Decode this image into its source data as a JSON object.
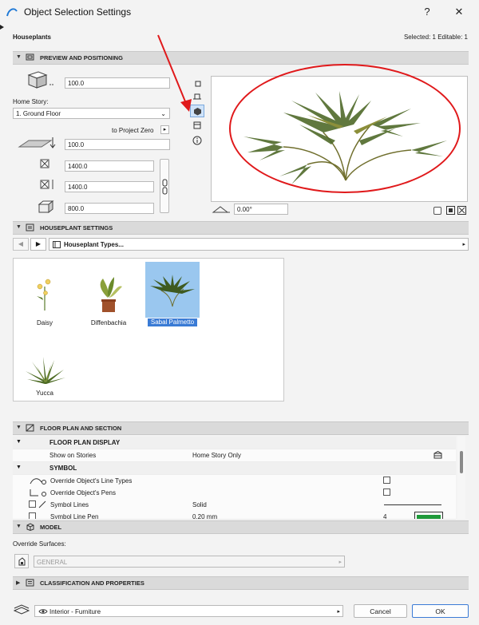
{
  "window": {
    "title": "Object Selection Settings",
    "help_label": "?",
    "close_label": "✕"
  },
  "header": {
    "object_name": "Houseplants",
    "selection_info": "Selected: 1 Editable: 1"
  },
  "preview_section": {
    "title": "PREVIEW AND POSITIONING",
    "offset_value": "100.0",
    "home_story_label": "Home Story:",
    "home_story_value": "1. Ground Floor",
    "project_zero_label": "to Project Zero",
    "elevation_value": "100.0",
    "width_value": "1400.0",
    "depth_value": "1400.0",
    "height_value": "800.0",
    "rotation_value": "0.00°"
  },
  "houseplant_section": {
    "title": "HOUSEPLANT SETTINGS",
    "page_select": "Houseplant Types...",
    "types": [
      {
        "label": "Daisy"
      },
      {
        "label": "Diffenbachia"
      },
      {
        "label": "Sabal Palmetto"
      },
      {
        "label": "Yucca"
      }
    ]
  },
  "floor_plan_section": {
    "title": "FLOOR PLAN AND SECTION",
    "rows": {
      "display_header": "FLOOR PLAN DISPLAY",
      "show_on_stories": "Show on Stories",
      "show_on_stories_value": "Home Story Only",
      "symbol_header": "SYMBOL",
      "override_line_types": "Override Object's Line Types",
      "override_pens": "Override Object's Pens",
      "symbol_lines": "Symbol Lines",
      "symbol_lines_value": "Solid",
      "symbol_line_pen": "Symbol Line Pen",
      "symbol_line_pen_value": "0.20 mm",
      "symbol_line_pen_number": "4"
    }
  },
  "model_section": {
    "title": "MODEL",
    "override_surfaces_label": "Override Surfaces:",
    "surface_value": "GENERAL"
  },
  "classification_section": {
    "title": "CLASSIFICATION AND PROPERTIES"
  },
  "footer": {
    "layer_value": "Interior - Furniture",
    "cancel_label": "Cancel",
    "ok_label": "OK"
  },
  "colors": {
    "annotation_red": "#e0191b",
    "selection_blue": "#3a7bd5",
    "pen_green": "#1f9a3a"
  }
}
